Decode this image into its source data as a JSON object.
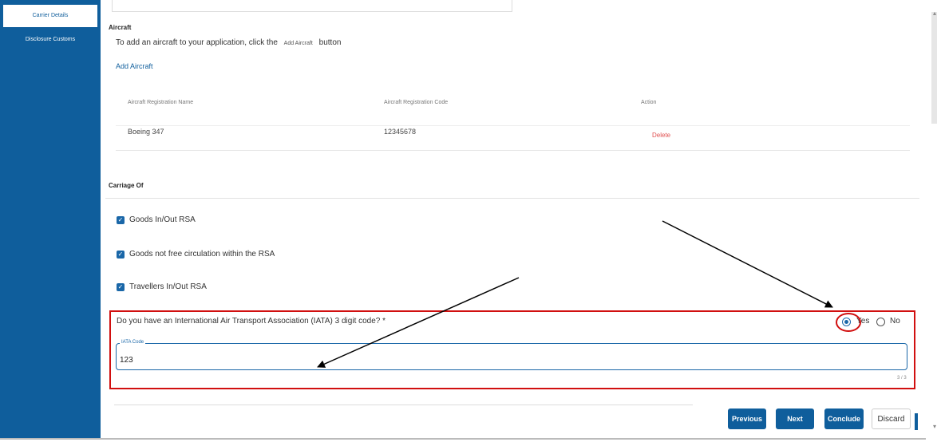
{
  "sidebar": {
    "items": [
      {
        "label": "Carrier Details",
        "active": true
      },
      {
        "label": "Disclosure Customs",
        "active": false
      }
    ]
  },
  "aircraft": {
    "heading": "Aircraft",
    "intro_before": "To add an aircraft to your application, click the",
    "intro_button": "Add Aircraft",
    "intro_after": "button",
    "add_link": "Add Aircraft",
    "columns": [
      "Aircraft Registration Name",
      "Aircraft Registration Code",
      "Action"
    ],
    "rows": [
      {
        "name": "Boeing 347",
        "code": "12345678",
        "action": "Delete"
      }
    ]
  },
  "carriage": {
    "heading": "Carriage Of",
    "options": [
      {
        "label": "Goods In/Out RSA",
        "checked": true
      },
      {
        "label": "Goods not free circulation within the RSA",
        "checked": true
      },
      {
        "label": "Travellers In/Out RSA",
        "checked": true
      }
    ]
  },
  "iata": {
    "question": "Do you have an International Air Transport Association (IATA) 3 digit code? *",
    "yes_label": "Yes",
    "no_label": "No",
    "selected": "Yes",
    "field_label": "IATA Code",
    "field_value": "123",
    "counter": "3 / 3"
  },
  "footer": {
    "previous": "Previous",
    "next": "Next",
    "conclude": "Conclude",
    "discard": "Discard"
  },
  "colors": {
    "brand": "#0f5e9c",
    "annotation": "#d10f0f",
    "delete": "#e05050"
  }
}
